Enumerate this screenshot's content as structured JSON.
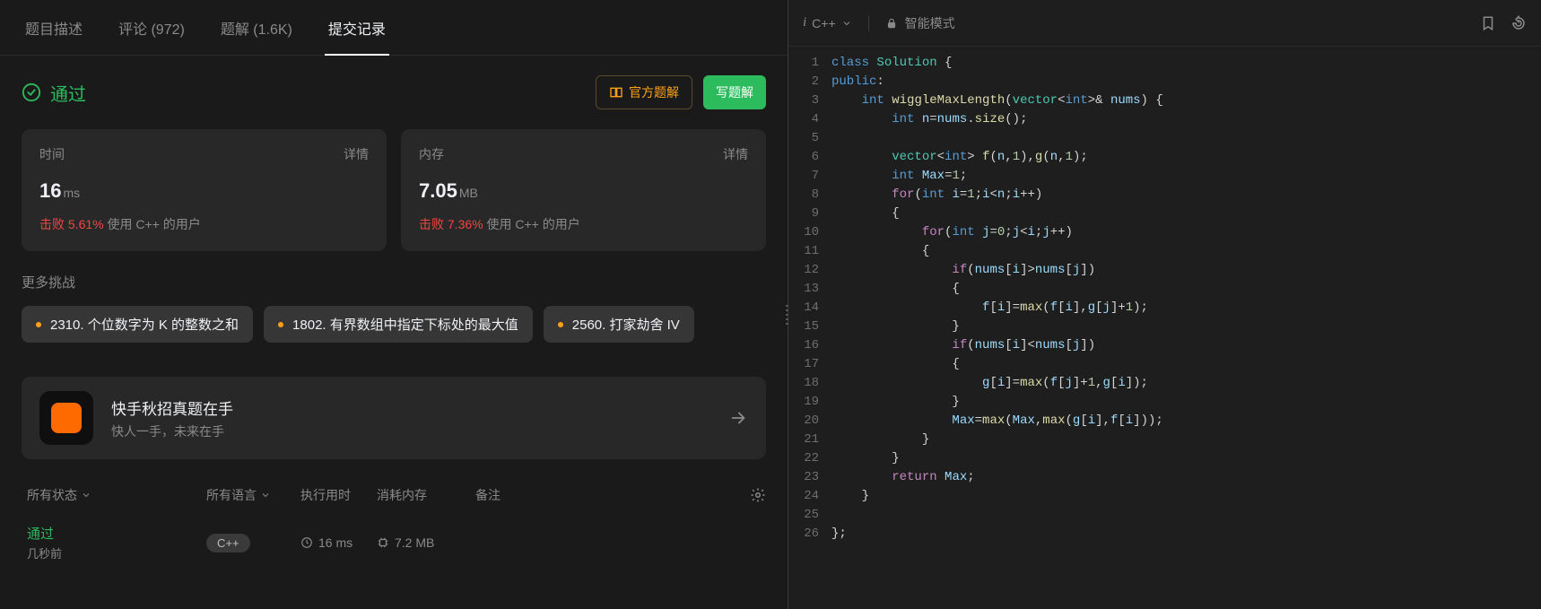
{
  "tabs": {
    "description": "题目描述",
    "comments": "评论 (972)",
    "solutions": "题解 (1.6K)",
    "submissions": "提交记录"
  },
  "status": {
    "label": "通过"
  },
  "buttons": {
    "official": "官方题解",
    "write": "写题解"
  },
  "cards": {
    "time": {
      "label": "时间",
      "detail": "详情",
      "value": "16",
      "unit": "ms",
      "beat_pre": "击败",
      "beat_pct": "5.61%",
      "beat_suf": "使用 C++ 的用户"
    },
    "mem": {
      "label": "内存",
      "detail": "详情",
      "value": "7.05",
      "unit": "MB",
      "beat_pre": "击败",
      "beat_pct": "7.36%",
      "beat_suf": "使用 C++ 的用户"
    }
  },
  "more": {
    "title": "更多挑战",
    "items": [
      "2310. 个位数字为 K 的整数之和",
      "1802. 有界数组中指定下标处的最大值",
      "2560. 打家劫舍 IV"
    ]
  },
  "promo": {
    "title": "快手秋招真题在手",
    "sub": "快人一手，未来在手"
  },
  "table": {
    "headers": {
      "status": "所有状态",
      "lang": "所有语言",
      "time": "执行用时",
      "mem": "消耗内存",
      "note": "备注"
    },
    "rows": [
      {
        "status": "通过",
        "ago": "几秒前",
        "lang": "C++",
        "time": "16 ms",
        "mem": "7.2 MB"
      }
    ]
  },
  "editor": {
    "lang": "C++",
    "mode": "智能模式",
    "lines": [
      1,
      2,
      3,
      4,
      5,
      6,
      7,
      8,
      9,
      10,
      11,
      12,
      13,
      14,
      15,
      16,
      17,
      18,
      19,
      20,
      21,
      22,
      23,
      24,
      25,
      26
    ],
    "code_plain": "class Solution {\npublic:\n    int wiggleMaxLength(vector<int>& nums) {\n        int n=nums.size();\n\n        vector<int> f(n,1),g(n,1);\n        int Max=1;\n        for(int i=1;i<n;i++)\n        {\n            for(int j=0;j<i;j++)\n            {\n                if(nums[i]>nums[j])\n                {\n                    f[i]=max(f[i],g[j]+1);\n                }\n                if(nums[i]<nums[j])\n                {\n                    g[i]=max(f[j]+1,g[i]);\n                }\n                Max=max(Max,max(g[i],f[i]));\n            }\n        }\n        return Max;\n    }\n    \n};"
  }
}
